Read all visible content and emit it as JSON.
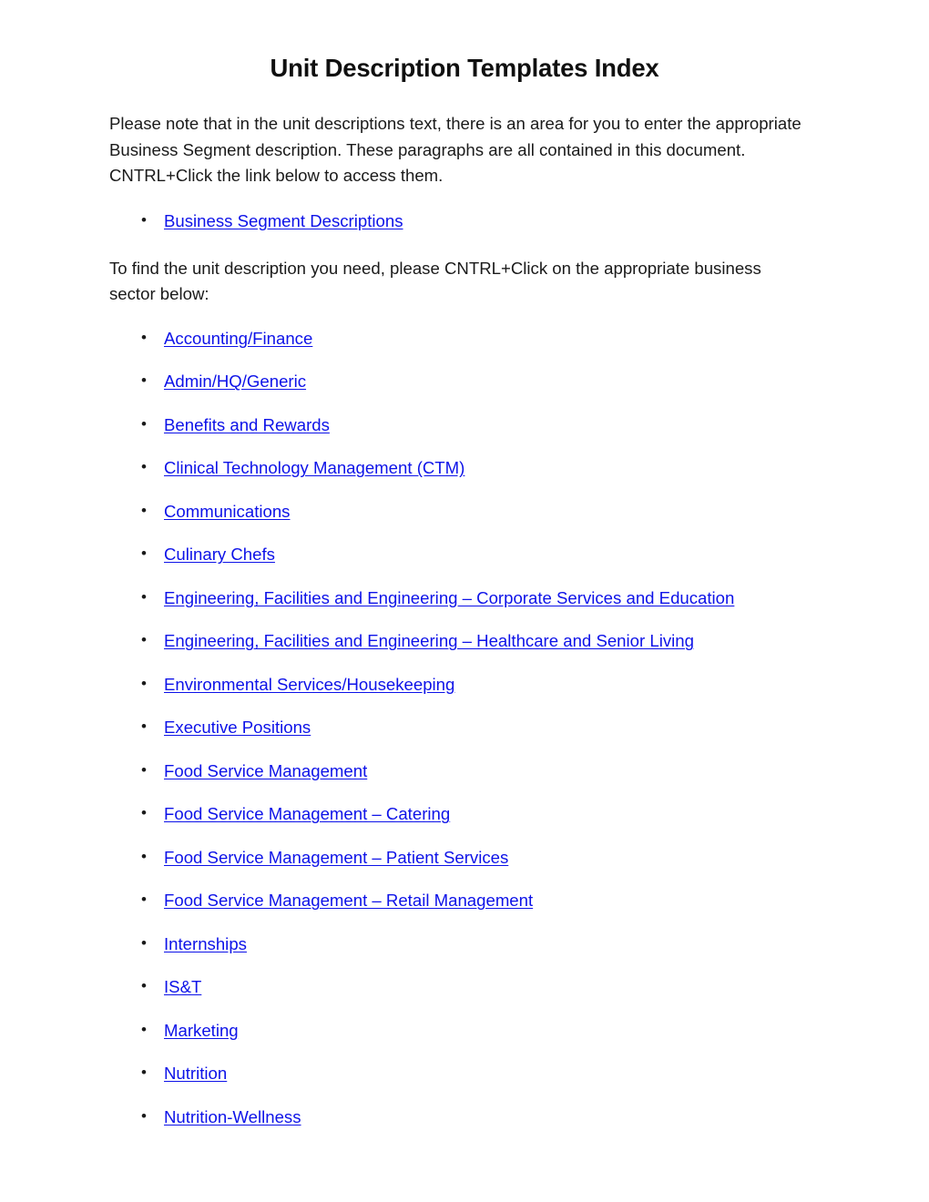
{
  "document": {
    "title": "Unit Description Templates Index",
    "intro_paragraph": "Please note that in the unit descriptions text, there is an area for you to enter the appropriate Business Segment description. These paragraphs are all contained in this document. CNTRL+Click the link below to access them.",
    "find_paragraph": "To find the unit description you need, please CNTRL+Click on the appropriate business sector below:",
    "bullet_glyph": "•",
    "link_color": "#0d12e8",
    "text_color": "#1a1a1a",
    "first_list": [
      {
        "label": "Business Segment Descriptions"
      }
    ],
    "sector_list": [
      {
        "label": "Accounting/Finance"
      },
      {
        "label": "Admin/HQ/Generic"
      },
      {
        "label": "Benefits and Rewards"
      },
      {
        "label": "Clinical Technology Management (CTM)"
      },
      {
        "label": "Communications"
      },
      {
        "label": "Culinary Chefs"
      },
      {
        "label": "Engineering, Facilities and Engineering – Corporate Services and Education"
      },
      {
        "label": "Engineering, Facilities and Engineering – Healthcare and Senior Living"
      },
      {
        "label": "Environmental Services/Housekeeping"
      },
      {
        "label": "Executive Positions"
      },
      {
        "label": "Food Service Management"
      },
      {
        "label": "Food Service Management – Catering"
      },
      {
        "label": "Food Service Management – Patient Services"
      },
      {
        "label": "Food Service Management – Retail Management"
      },
      {
        "label": "Internships"
      },
      {
        "label": "IS&T"
      },
      {
        "label": "Marketing"
      },
      {
        "label": "Nutrition"
      },
      {
        "label": "Nutrition-Wellness"
      }
    ]
  }
}
